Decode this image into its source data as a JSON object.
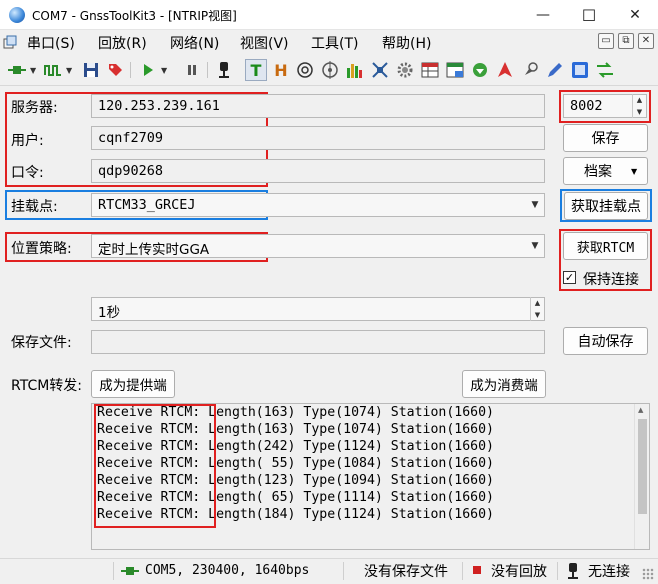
{
  "window": {
    "title": "COM7 - GnssToolKit3 - [NTRIP视图]",
    "controls": {
      "minimize": "—",
      "maximize": "☐",
      "close": "✕"
    }
  },
  "menu": {
    "items": [
      "串口(S)",
      "回放(R)",
      "网络(N)",
      "视图(V)",
      "工具(T)",
      "帮助(H)"
    ],
    "mdi_controls": [
      "▭",
      "⧉",
      "✕"
    ]
  },
  "toolbar": {
    "buttons": [
      "serial-connect-icon",
      "signal-icon",
      "save-icon",
      "tag-icon",
      "play-icon",
      "pause-icon",
      "antenna-icon",
      "t-icon",
      "h-icon",
      "target-icon",
      "target2-icon",
      "bar-chart-icon",
      "satellite-icon",
      "gear-icon",
      "table-icon",
      "grid-icon",
      "download-icon",
      "arrow-up-icon",
      "pin-icon",
      "pen-icon",
      "pps-icon",
      "swap-icon"
    ],
    "pressed": [
      "t-icon"
    ]
  },
  "form": {
    "server_label": "服务器:",
    "server_value": "120.253.239.161",
    "port_value": "8002",
    "user_label": "用户:",
    "user_value": "cqnf2709",
    "password_label": "口令:",
    "password_value": "qdp90268",
    "mountpoint_label": "挂载点:",
    "mountpoint_value": "RTCM33_GRCEJ",
    "position_label": "位置策略:",
    "position_value": "定时上传实时GGA",
    "interval_value": "1秒",
    "save_file_label": "保存文件:",
    "save_file_value": "",
    "rtcm_forward_label": "RTCM转发:"
  },
  "buttons": {
    "save": "保存",
    "archive": "档案",
    "get_mountpoints": "获取挂载点",
    "get_rtcm": "获取RTCM",
    "keep_connection": "保持连接",
    "auto_save": "自动保存",
    "become_provider": "成为提供端",
    "become_consumer": "成为消费端"
  },
  "keep_connection_checked": true,
  "log": {
    "lines": [
      {
        "prefix": "Receive RTCM:",
        "rest": " Length(163) Type(1074) Station(1660)"
      },
      {
        "prefix": "Receive RTCM:",
        "rest": " Length(163) Type(1074) Station(1660)"
      },
      {
        "prefix": "Receive RTCM:",
        "rest": " Length(242) Type(1124) Station(1660)"
      },
      {
        "prefix": "Receive RTCM:",
        "rest": " Length( 55) Type(1084) Station(1660)"
      },
      {
        "prefix": "Receive RTCM:",
        "rest": " Length(123) Type(1094) Station(1660)"
      },
      {
        "prefix": "Receive RTCM:",
        "rest": " Length( 65) Type(1114) Station(1660)"
      },
      {
        "prefix": "Receive RTCM:",
        "rest": " Length(184) Type(1124) Station(1660)"
      }
    ]
  },
  "status": {
    "port": "COM5, 230400, 1640bps",
    "save_status": "没有保存文件",
    "playback_status": "没有回放",
    "connection_status": "无连接"
  },
  "colors": {
    "highlight_red": "#e02020",
    "highlight_blue": "#1a7ee0"
  }
}
